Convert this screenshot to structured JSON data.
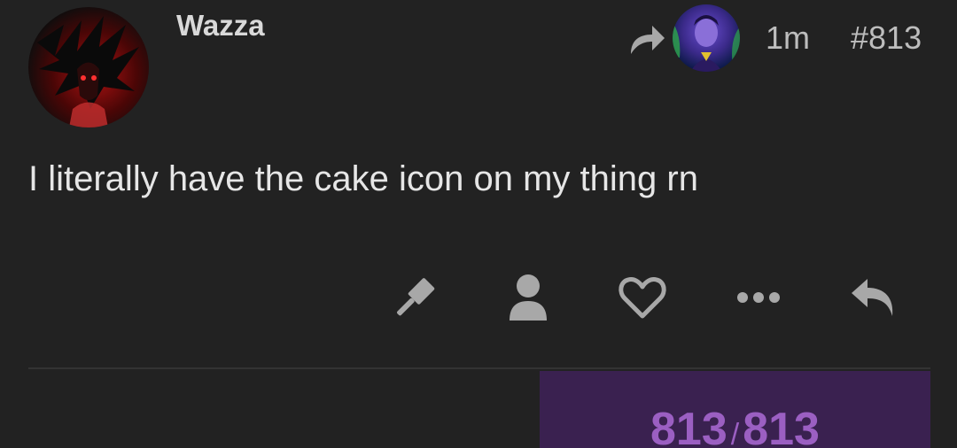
{
  "post": {
    "username": "Wazza",
    "time": "1m",
    "post_number": "#813",
    "body": "I literally have the cake icon on my thing rn"
  },
  "icons": {
    "reply_to": "reply-to-arrow-icon",
    "moderate": "gavel-icon",
    "profile": "user-icon",
    "like": "heart-icon",
    "more": "ellipsis-icon",
    "reply": "reply-icon"
  },
  "progress": {
    "current": "813",
    "separator": "/",
    "total": "813"
  },
  "colors": {
    "background": "#222222",
    "icon": "#a8a8a8",
    "progress_bg": "#3a2150",
    "progress_text": "#9b5fc2"
  }
}
